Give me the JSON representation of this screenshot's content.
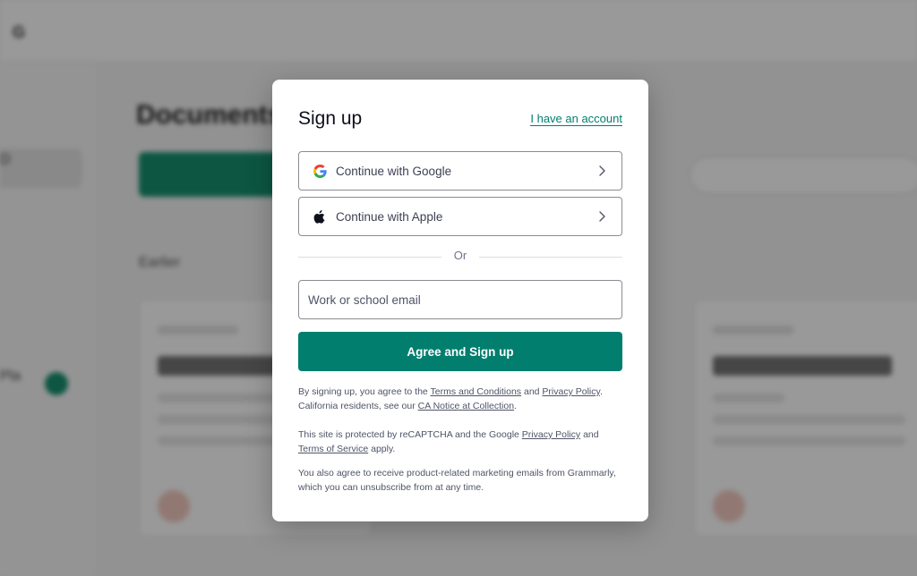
{
  "background": {
    "logo": "G",
    "page_title": "Documents",
    "side_text_1": "D",
    "side_text_2": "Pla",
    "section_label": "Earlier"
  },
  "modal": {
    "title": "Sign up",
    "have_account_link": "I have an account",
    "google_button": {
      "label": "Continue with Google",
      "icon": "google-icon"
    },
    "apple_button": {
      "label": "Continue with Apple",
      "icon": "apple-icon"
    },
    "divider_text": "Or",
    "email": {
      "placeholder": "Work or school email",
      "value": ""
    },
    "primary_button": "Agree and Sign up",
    "legal": {
      "p1_before": "By signing up, you agree to the ",
      "terms_link": "Terms and Conditions",
      "p1_and": " and ",
      "privacy_link": "Privacy Policy",
      "p1_mid": ". California residents, see our ",
      "ca_notice_link": "CA Notice at Collection",
      "p1_end": ".",
      "p2_before": "This site is protected by reCAPTCHA and the Google ",
      "google_privacy_link": "Privacy Policy",
      "p2_and": " and ",
      "google_terms_link": "Terms of Service",
      "p2_end": " apply.",
      "p3": "You also agree to receive product-related marketing emails from Grammarly, which you can unsubscribe from at any time."
    }
  },
  "colors": {
    "brand": "#027e6f",
    "overlay": "rgba(0,0,0,0.40)"
  }
}
